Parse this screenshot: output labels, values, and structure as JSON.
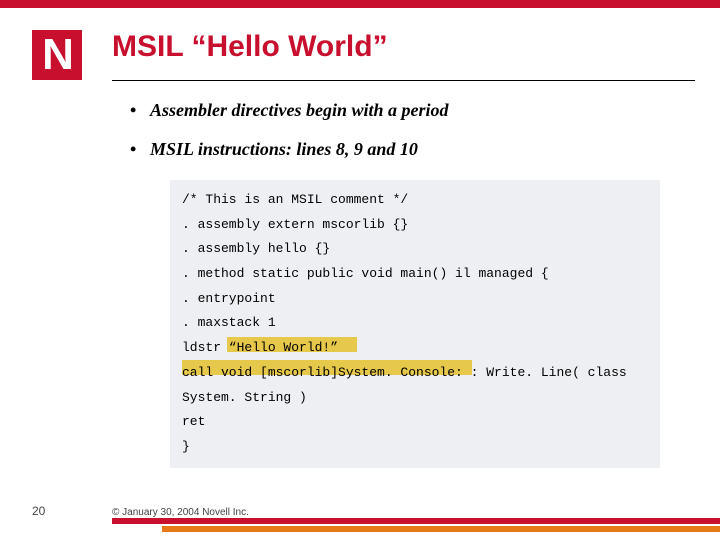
{
  "logo_letter": "N",
  "title": "MSIL “Hello World”",
  "bullets": [
    "Assembler directives begin with a period",
    "MSIL instructions: lines 8, 9 and 10"
  ],
  "code": [
    "/* This is an MSIL comment */",
    ". assembly extern mscorlib {}",
    ". assembly hello {}",
    ". method static public void main() il managed {",
    ". entrypoint",
    ". maxstack 1",
    "ldstr “Hello World!”",
    "call void [mscorlib]System. Console: : Write. Line( class System. String )",
    "ret",
    "}"
  ],
  "page_number": "20",
  "copyright": "© January 30, 2004 Novell Inc."
}
